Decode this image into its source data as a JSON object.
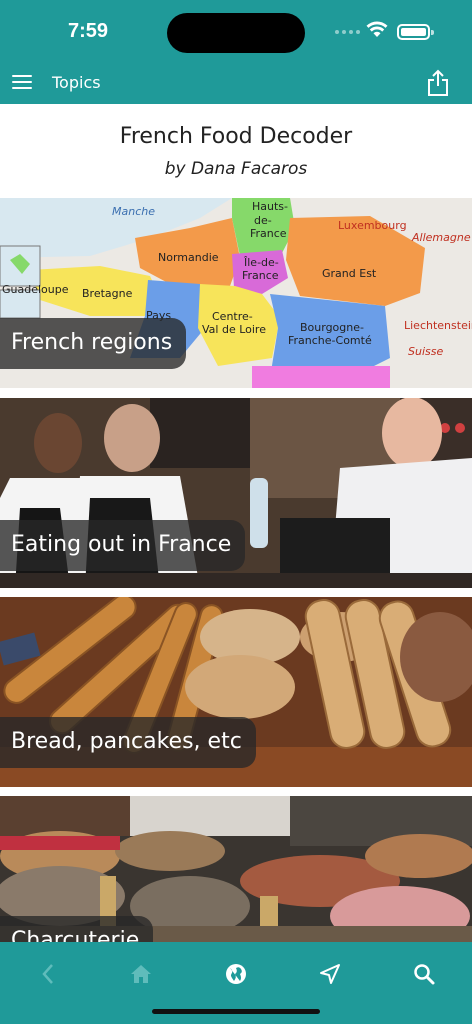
{
  "status_bar": {
    "time": "7:59"
  },
  "app_bar": {
    "title": "Topics"
  },
  "book": {
    "title": "French Food Decoder",
    "author": "by Dana Facaros"
  },
  "map_labels": [
    "Manche",
    "Hauts-de-France",
    "Luxembourg",
    "Allemagne",
    "Normandie",
    "Île-de-France",
    "Grand Est",
    "Guadeloupe",
    "Bretagne",
    "Pays",
    "Centre-Val de Loire",
    "Bourgogne-Franche-Comté",
    "Liechtenstein",
    "Suisse"
  ],
  "topics": [
    {
      "label": "French regions"
    },
    {
      "label": "Eating out in France"
    },
    {
      "label": "Bread, pancakes, etc"
    },
    {
      "label": "Charcuterie"
    }
  ],
  "tabs": [
    {
      "name": "back-icon",
      "enabled": false
    },
    {
      "name": "home-icon",
      "enabled": false
    },
    {
      "name": "globe-icon",
      "enabled": true
    },
    {
      "name": "navigation-icon",
      "enabled": true
    },
    {
      "name": "search-icon",
      "enabled": true
    }
  ],
  "colors": {
    "brand": "#1f9a99",
    "label_bg": "#333333"
  }
}
